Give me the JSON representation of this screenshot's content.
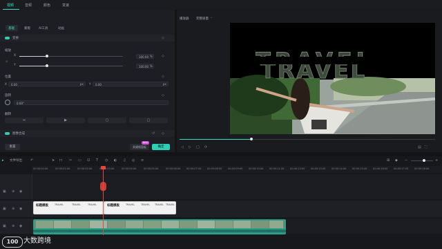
{
  "top_tabs": [
    "视频",
    "音频",
    "颜色",
    "变速"
  ],
  "sub_tabs": [
    "基础",
    "蒙版",
    "AI工具",
    "动画"
  ],
  "transform": {
    "title": "变换",
    "scale_label": "缩放",
    "x_label": "X",
    "y_label": "Y",
    "scale_x": "100.00",
    "scale_y": "100.00",
    "percent": "%",
    "position_label": "位置",
    "pos_x_label": "X",
    "pos_x": "0.00",
    "px": "px",
    "pos_y_label": "Y",
    "pos_y": "0.00",
    "rotate_label": "旋转",
    "rotate_value": "0.00°",
    "flip_label": "翻转"
  },
  "compositing": {
    "title": "图像合成"
  },
  "buttons": {
    "reset": "重置",
    "keyframe": "关键帧面板",
    "new_badge": "NEW",
    "ok": "确定"
  },
  "preview": {
    "tab1": "播放器",
    "tab2": "完整质量",
    "overlay_text": "TRAVEL"
  },
  "timeline": {
    "first_label": "文件导出",
    "ruler": [
      "00:00:00:00",
      "00:00:01:00",
      "00:00:02:00",
      "00:00:03:00",
      "00:00:04:00",
      "00:00:05:00",
      "00:00:06:00",
      "00:00:07:00",
      "00:00:08:00",
      "00:00:09:00",
      "00:00:10:00",
      "00:00:11:00",
      "00:00:12:00",
      "00:00:13:00",
      "00:00:14:00",
      "00:00:15:00",
      "00:00:16:00",
      "00:00:17:00",
      "00:00:18:00"
    ],
    "title_clip_label": "标题模板",
    "title_clip_items": [
      "TRAVEL",
      "TRAVEL",
      "TRAVEL"
    ],
    "title_clip2_label": "标题模板",
    "title_clip2_items": [
      "TRAVEL",
      "TRAVEL",
      "TRAVEL",
      "TRAVEL"
    ]
  },
  "watermark": {
    "badge": "100",
    "text": "大数跨境"
  },
  "colors": {
    "accent": "#36e0c2",
    "playhead": "#e8453c",
    "video_clip": "#2f9c8a",
    "title_clip": "#f2f2f2"
  }
}
